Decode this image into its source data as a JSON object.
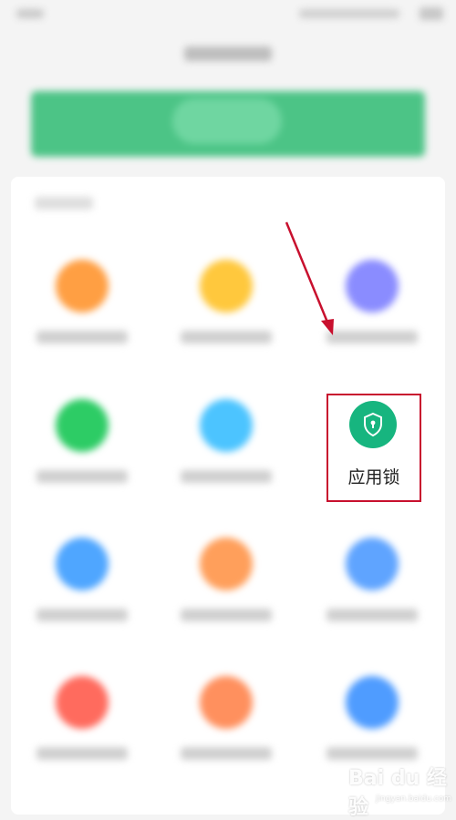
{
  "highlighted_app": {
    "label": "应用锁",
    "icon": "shield-lock-icon",
    "icon_color": "#17b57f"
  },
  "grid_icon_colors": [
    "#ff9f43",
    "#ffc83d",
    "#8a8cff",
    "#2dcc65",
    "#4cc4ff",
    "#4fa6ff",
    "#ff9f5b",
    "#5fa4ff",
    "#ff6b5e",
    "#ff905e",
    "#4f9cff"
  ],
  "banner_color": "#4cc486",
  "annotation": {
    "box_color": "#c8102e",
    "arrow_color": "#c8102e"
  },
  "watermark": {
    "main": "Bai du 经验",
    "sub": "jingyan.baidu.com"
  }
}
